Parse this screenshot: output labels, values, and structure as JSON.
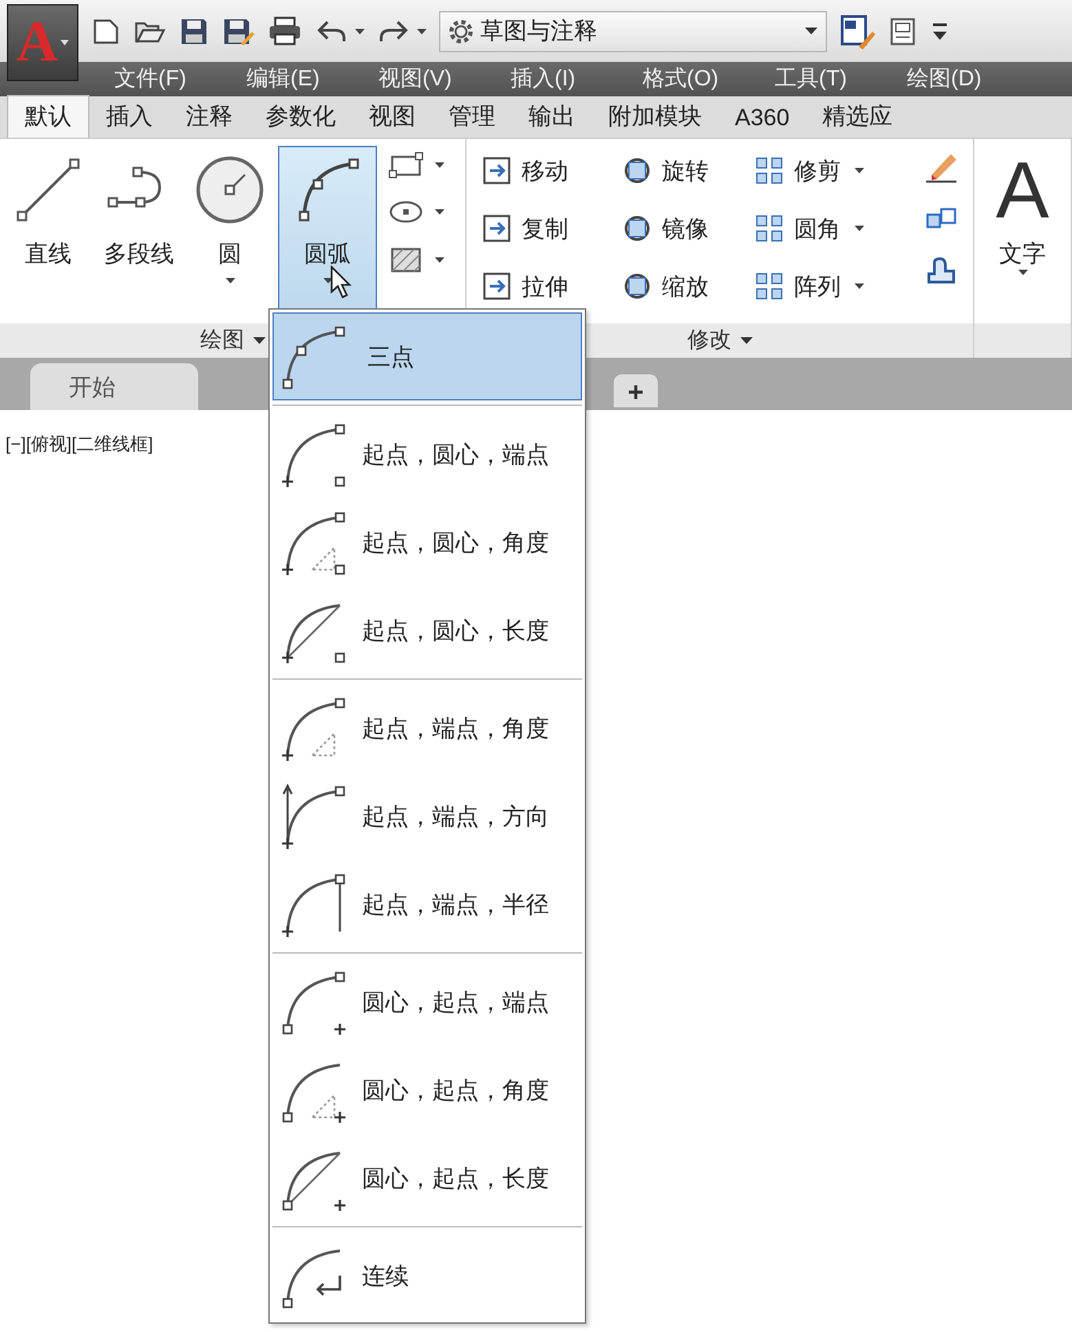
{
  "app_button": {
    "label": "A"
  },
  "quick_access": {
    "workspace": "草图与注释"
  },
  "menu_bar": [
    "文件(F)",
    "编辑(E)",
    "视图(V)",
    "插入(I)",
    "格式(O)",
    "工具(T)",
    "绘图(D)"
  ],
  "ribbon_tabs": [
    {
      "label": "默认",
      "selected": true
    },
    {
      "label": "插入",
      "selected": false
    },
    {
      "label": "注释",
      "selected": false
    },
    {
      "label": "参数化",
      "selected": false
    },
    {
      "label": "视图",
      "selected": false
    },
    {
      "label": "管理",
      "selected": false
    },
    {
      "label": "输出",
      "selected": false
    },
    {
      "label": "附加模块",
      "selected": false
    },
    {
      "label": "A360",
      "selected": false
    },
    {
      "label": "精选应",
      "selected": false
    }
  ],
  "draw_panel": {
    "title": "绘图",
    "tools": [
      {
        "label": "直线",
        "has_menu": false,
        "selected": false
      },
      {
        "label": "多段线",
        "has_menu": false,
        "selected": false
      },
      {
        "label": "圆",
        "has_menu": true,
        "selected": false
      },
      {
        "label": "圆弧",
        "has_menu": true,
        "selected": true
      }
    ]
  },
  "modify_panel": {
    "title": "修改",
    "tools": [
      {
        "label": "移动",
        "has_menu": false
      },
      {
        "label": "旋转",
        "has_menu": false
      },
      {
        "label": "修剪",
        "has_menu": true
      },
      {
        "label": "复制",
        "has_menu": false
      },
      {
        "label": "镜像",
        "has_menu": false
      },
      {
        "label": "圆角",
        "has_menu": true
      },
      {
        "label": "拉伸",
        "has_menu": false
      },
      {
        "label": "缩放",
        "has_menu": false
      },
      {
        "label": "阵列",
        "has_menu": true
      }
    ]
  },
  "annotation_panel": {
    "letter": "A",
    "tools": [
      {
        "label": "文字",
        "has_menu": true
      }
    ]
  },
  "file_tabs": [
    {
      "label": "开始"
    }
  ],
  "viewport_label": "[−][俯视][二维线框]",
  "arc_menu": {
    "groups": [
      [
        {
          "label": "三点",
          "selected": true
        }
      ],
      [
        {
          "label": "起点，圆心，端点",
          "selected": false
        },
        {
          "label": "起点，圆心，角度",
          "selected": false
        },
        {
          "label": "起点，圆心，长度",
          "selected": false
        }
      ],
      [
        {
          "label": "起点，端点，角度",
          "selected": false
        },
        {
          "label": "起点，端点，方向",
          "selected": false
        },
        {
          "label": "起点，端点，半径",
          "selected": false
        }
      ],
      [
        {
          "label": "圆心，起点，端点",
          "selected": false
        },
        {
          "label": "圆心，起点，角度",
          "selected": false
        },
        {
          "label": "圆心，起点，长度",
          "selected": false
        }
      ],
      [
        {
          "label": "连续",
          "selected": false
        }
      ]
    ]
  }
}
